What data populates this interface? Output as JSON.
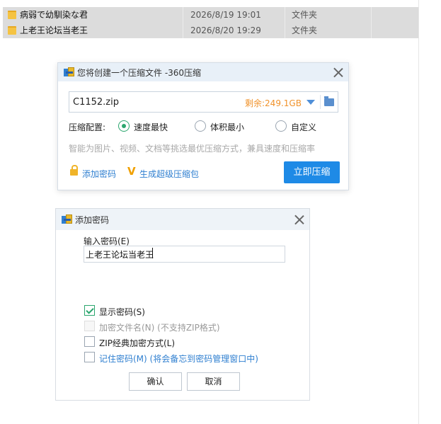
{
  "explorer": {
    "rows": [
      {
        "name": "病弱で幼馴染な君",
        "date": "2026/8/19 19:01",
        "type": "文件夹"
      },
      {
        "name": "上老王论坛当老王",
        "date": "2026/8/20 19:29",
        "type": "文件夹"
      }
    ]
  },
  "compress_dialog": {
    "title": "您将创建一个压缩文件 -360压缩",
    "filename": "C1152.zip",
    "free_space": "剩余:249.1GB",
    "config_label": "压缩配置:",
    "options": [
      {
        "label": "速度最快",
        "selected": true
      },
      {
        "label": "体积最小",
        "selected": false
      },
      {
        "label": "自定义",
        "selected": false
      }
    ],
    "hint": "智能为图片、视频、文档等挑选最优压缩方式，兼具速度和压缩率",
    "add_password": "添加密码",
    "super_pack": "生成超级压缩包",
    "compress_button": "立即压缩"
  },
  "password_dialog": {
    "title": "添加密码",
    "input_label": "输入密码(E)",
    "password_value": "上老王论坛当老王",
    "checkboxes": [
      {
        "label": "显示密码(S)",
        "checked": true,
        "enabled": true
      },
      {
        "label": "加密文件名(N) (不支持ZIP格式)",
        "checked": false,
        "enabled": false
      },
      {
        "label": "ZIP经典加密方式(L)",
        "checked": false,
        "enabled": true
      },
      {
        "label": "记住密码(M) (将会备忘到密码管理窗口中)",
        "checked": false,
        "enabled": true
      }
    ],
    "ok_button": "确认",
    "cancel_button": "取消"
  },
  "colors": {
    "accent": "#1e8ae6",
    "check_green": "#2ba66e",
    "space_orange": "#f0922b"
  }
}
